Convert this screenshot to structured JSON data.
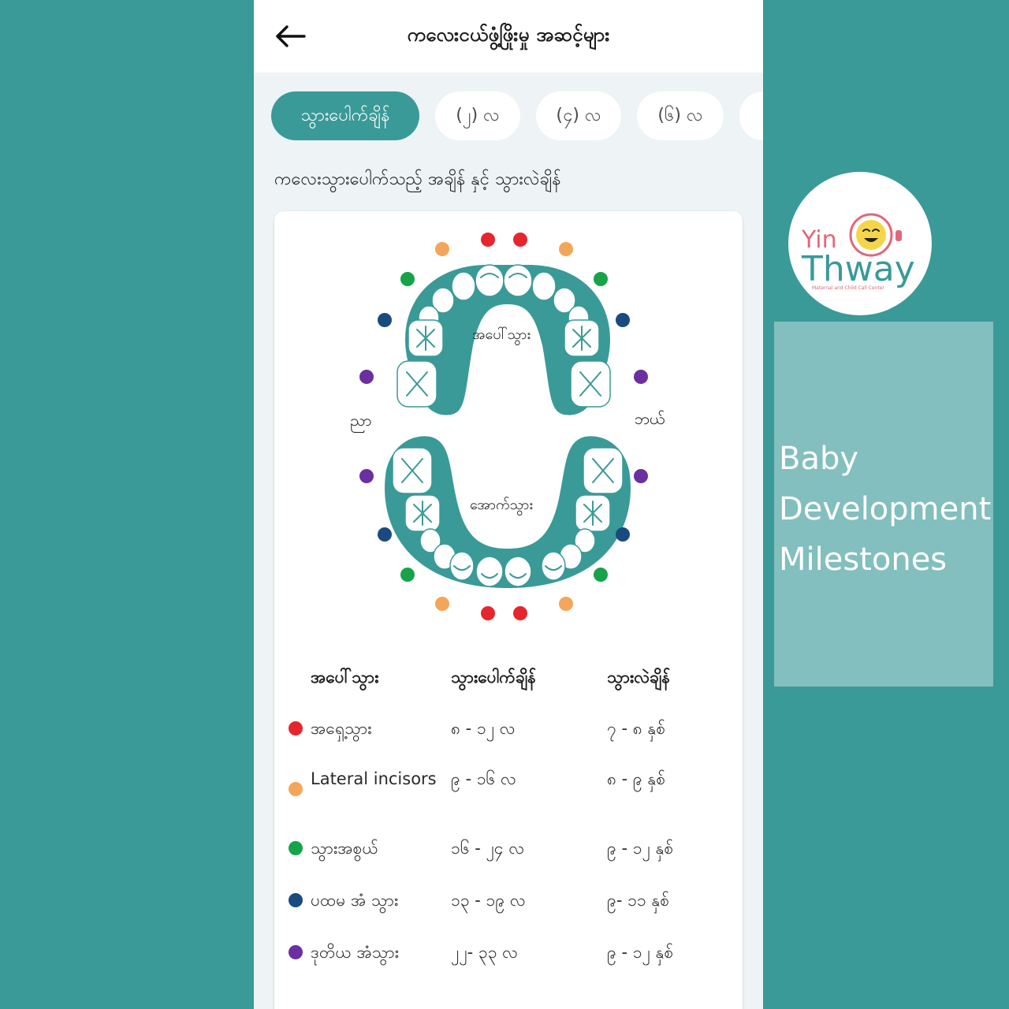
{
  "app": {
    "title": "ကလေးငယ်ဖွံ့ဖြိုးမှု အဆင့်များ",
    "tabs": [
      {
        "label": "သွားပေါက်ချိန်",
        "active": true
      },
      {
        "label": "(၂) လ",
        "active": false
      },
      {
        "label": "(၄) လ",
        "active": false
      },
      {
        "label": "(၆) လ",
        "active": false
      },
      {
        "label": "",
        "active": false
      }
    ],
    "section_label": "ကလေးသွားပေါက်သည့် အချိန် နှင့် သွားလဲချိန်"
  },
  "diagram": {
    "upper_label": "အပေါ်သွား",
    "lower_label": "အောက်သွား",
    "right_side_label": "ညာ",
    "left_side_label": "ဘယ်"
  },
  "colors": {
    "teal": "#3a9a98",
    "central_incisor": "#e5262f",
    "lateral_incisor": "#f3a65a",
    "canine": "#16a34a",
    "first_molar": "#1a4a80",
    "second_molar": "#6b2fa0"
  },
  "table": {
    "headers": [
      "အပေါ်သွား",
      "သွားပေါက်ချိန်",
      "သွားလဲချိန်"
    ],
    "rows": [
      {
        "name": "အရှေ့သွား",
        "erupt": "၈ - ၁၂ လ",
        "shed": "၇ - ၈ နှစ်",
        "color": "#e5262f"
      },
      {
        "name": "Lateral incisors",
        "erupt": "၉ - ၁၆ လ",
        "shed": "၈ - ၉ နှစ်",
        "color": "#f3a65a"
      },
      {
        "name": "သွားအစွယ်",
        "erupt": "၁၆ - ၂၄ လ",
        "shed": "၉ - ၁၂ နှစ်",
        "color": "#16a34a"
      },
      {
        "name": "ပထမ အံ သွား",
        "erupt": "၁၃ - ၁၉ လ",
        "shed": "၉- ၁၁ နှစ်",
        "color": "#1a4a80"
      },
      {
        "name": "ဒုတိယ အံသွား",
        "erupt": "၂၂- ၃၃ လ",
        "shed": "၉ - ၁၂ နှစ်",
        "color": "#6b2fa0"
      }
    ]
  },
  "brand": {
    "logo_word1": "Yin",
    "logo_word2": "Thway",
    "logo_subtitle": "Maternal and Child Call Center"
  },
  "promo": {
    "line1": "Baby",
    "line2": "Development",
    "line3": "Milestones"
  }
}
